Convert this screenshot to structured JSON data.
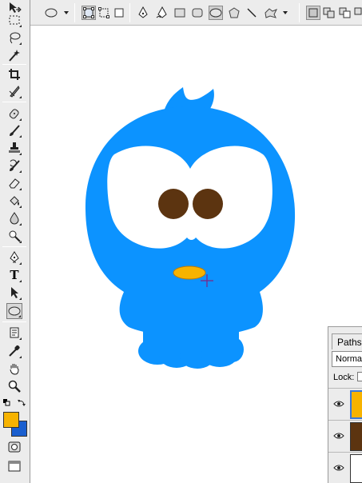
{
  "options_bar": {
    "preset_icon": "ellipse-preset-icon",
    "modes": [
      "shape-layers-icon",
      "paths-icon",
      "fill-pixels-icon"
    ],
    "shape_tools": [
      "pen-icon",
      "freeform-pen-icon",
      "rectangle-icon",
      "rounded-rectangle-icon",
      "ellipse-icon",
      "polygon-icon",
      "line-icon",
      "custom-shape-icon"
    ],
    "selected_shape_tool": "ellipse-icon",
    "combine_modes": [
      "create-new-shape-icon",
      "add-to-shape-icon",
      "subtract-from-shape-icon"
    ]
  },
  "toolbox": {
    "tools": [
      "move-icon",
      "marquee-icon",
      "lasso-icon",
      "magic-wand-icon",
      "crop-icon",
      "slice-icon",
      "healing-brush-icon",
      "brush-icon",
      "clone-stamp-icon",
      "history-brush-icon",
      "eraser-icon",
      "paint-bucket-icon",
      "blur-icon",
      "dodge-icon",
      "pen-tool-icon",
      "type-tool-icon",
      "path-selection-icon",
      "ellipse-tool-icon",
      "notes-icon",
      "eyedropper-icon",
      "hand-icon",
      "zoom-icon"
    ],
    "type_tool_glyph": "T",
    "selected_tool": "ellipse-tool-icon",
    "foreground_color": "#f7b300",
    "background_color": "#1a5fcf"
  },
  "canvas": {
    "background": "#ffffff",
    "bird_color": "#0c93ff",
    "eye_white": "#ffffff",
    "pupil_color": "#5c3410",
    "beak_color": "#f7b300",
    "beak_outline": "#c07a00",
    "cursor_color": "#7a2a8a"
  },
  "layers_panel": {
    "tab_label": "Paths",
    "blend_mode": "Normal",
    "lock_label": "Lock:",
    "layers": [
      {
        "thumb_color": "#f7b300",
        "active": true
      },
      {
        "thumb_color": "#5c3410",
        "active": false
      },
      {
        "thumb_color": "#ffffff",
        "active": false
      }
    ]
  }
}
